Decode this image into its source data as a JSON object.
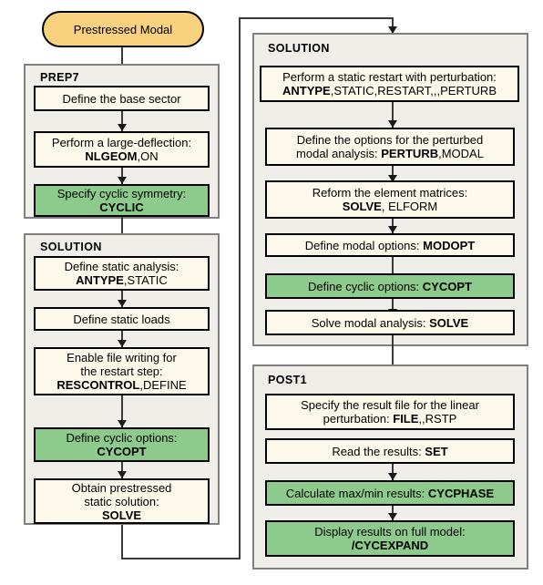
{
  "diagram": {
    "title": "Prestressed Modal cyclic symmetry analysis flowchart",
    "terminator": {
      "label": "Prestressed Modal"
    },
    "colors": {
      "terminator_fill": "#FAD17E",
      "box_fill": "#FDF9EA",
      "highlight_fill": "#8CCB8B",
      "group_fill": "#EFEEE9",
      "group_border": "#808080",
      "box_border": "#000000",
      "connector": "#3a3a3a"
    },
    "groups": [
      {
        "id": "prep7",
        "title": "PREP7",
        "column": "left",
        "steps": [
          {
            "id": "define-base-sector",
            "lines": [
              "Define the base sector"
            ],
            "highlight": false
          },
          {
            "id": "large-deflection",
            "lines": [
              "Perform a large-deflection:",
              "NLGEOM,ON"
            ],
            "highlight": false
          },
          {
            "id": "specify-cyclic-symmetry",
            "lines": [
              "Specify cyclic symmetry:",
              "CYCLIC"
            ],
            "highlight": true
          }
        ]
      },
      {
        "id": "solution-left",
        "title": "SOLUTION",
        "column": "left",
        "steps": [
          {
            "id": "define-static-analysis",
            "lines": [
              "Define static analysis:",
              "ANTYPE,STATIC"
            ],
            "highlight": false
          },
          {
            "id": "define-static-loads",
            "lines": [
              "Define static loads"
            ],
            "highlight": false
          },
          {
            "id": "enable-file-writing",
            "lines": [
              "Enable file writing for",
              "the restart step:",
              "RESCONTROL,DEFINE"
            ],
            "highlight": false
          },
          {
            "id": "define-cyclic-options-static",
            "lines": [
              "Define cyclic options:",
              "CYCOPT"
            ],
            "highlight": true
          },
          {
            "id": "obtain-prestressed-solution",
            "lines": [
              "Obtain prestressed",
              "static solution:",
              "SOLVE"
            ],
            "highlight": false
          }
        ]
      },
      {
        "id": "solution-right",
        "title": "SOLUTION",
        "column": "right",
        "steps": [
          {
            "id": "static-restart-perturbation",
            "lines": [
              "Perform a static restart with perturbation:",
              "ANTYPE,STATIC,RESTART,,,PERTURB"
            ],
            "highlight": false
          },
          {
            "id": "define-perturbed-modal-options",
            "lines": [
              "Define the options for the perturbed",
              "modal analysis: PERTURB,MODAL"
            ],
            "highlight": false
          },
          {
            "id": "reform-element-matrices",
            "lines": [
              "Reform the element matrices:",
              "SOLVE, ELFORM"
            ],
            "highlight": false
          },
          {
            "id": "define-modal-options",
            "lines": [
              "Define modal options: MODOPT"
            ],
            "highlight": false
          },
          {
            "id": "define-cyclic-options-modal",
            "lines": [
              "Define cyclic options: CYCOPT"
            ],
            "highlight": true
          },
          {
            "id": "solve-modal-analysis",
            "lines": [
              "Solve modal analysis: SOLVE"
            ],
            "highlight": false
          }
        ]
      },
      {
        "id": "post1",
        "title": "POST1",
        "column": "right",
        "steps": [
          {
            "id": "specify-result-file",
            "lines": [
              "Specify the result file for the linear",
              "perturbation: FILE,,RSTP"
            ],
            "highlight": false
          },
          {
            "id": "read-results",
            "lines": [
              "Read the results: SET"
            ],
            "highlight": false
          },
          {
            "id": "calculate-max-min",
            "lines": [
              "Calculate max/min results: CYCPHASE"
            ],
            "highlight": true
          },
          {
            "id": "display-full-model",
            "lines": [
              "Display results on full model:",
              "/CYCEXPAND"
            ],
            "highlight": true
          }
        ]
      }
    ],
    "boxes": {
      "define-base-sector": {
        "text_html": "Define the base sector"
      },
      "large-deflection": {
        "text_html": "Perform a large-deflection:<br><b>NLGEOM</b>,ON"
      },
      "specify-cyclic-symmetry": {
        "text_html": "Specify cyclic symmetry:<br><b>CYCLIC</b>"
      },
      "define-static-analysis": {
        "text_html": "Define static analysis:<br><b>ANTYPE</b>,STATIC"
      },
      "define-static-loads": {
        "text_html": "Define static loads"
      },
      "enable-file-writing": {
        "text_html": "Enable file writing for<br>the restart step:<br><b>RESCONTROL</b>,DEFINE"
      },
      "define-cyclic-options-static": {
        "text_html": "Define cyclic options:<br><b>CYCOPT</b>"
      },
      "obtain-prestressed-solution": {
        "text_html": "Obtain prestressed<br>static solution:<br><b>SOLVE</b>"
      },
      "static-restart-perturbation": {
        "text_html": "Perform a static restart with perturbation:<br><b>ANTYPE</b>,STATIC,RESTART,,,PERTURB"
      },
      "define-perturbed-modal-options": {
        "text_html": "Define the options for the perturbed<br>modal analysis: <b>PERTURB</b>,MODAL"
      },
      "reform-element-matrices": {
        "text_html": "Reform the element matrices:<br><b>SOLVE</b>, ELFORM"
      },
      "define-modal-options": {
        "text_html": "Define modal options: <b>MODOPT</b>"
      },
      "define-cyclic-options-modal": {
        "text_html": "Define cyclic options: <b>CYCOPT</b>"
      },
      "solve-modal-analysis": {
        "text_html": "Solve modal analysis: <b>SOLVE</b>"
      },
      "specify-result-file": {
        "text_html": "Specify the result file for the linear<br>perturbation: <b>FILE</b>,,RSTP"
      },
      "read-results": {
        "text_html": "Read the results: <b>SET</b>"
      },
      "calculate-max-min": {
        "text_html": "Calculate max/min results: <b>CYCPHASE</b>"
      },
      "display-full-model": {
        "text_html": "Display results on full model:<br><b>/CYCEXPAND</b>"
      }
    }
  }
}
